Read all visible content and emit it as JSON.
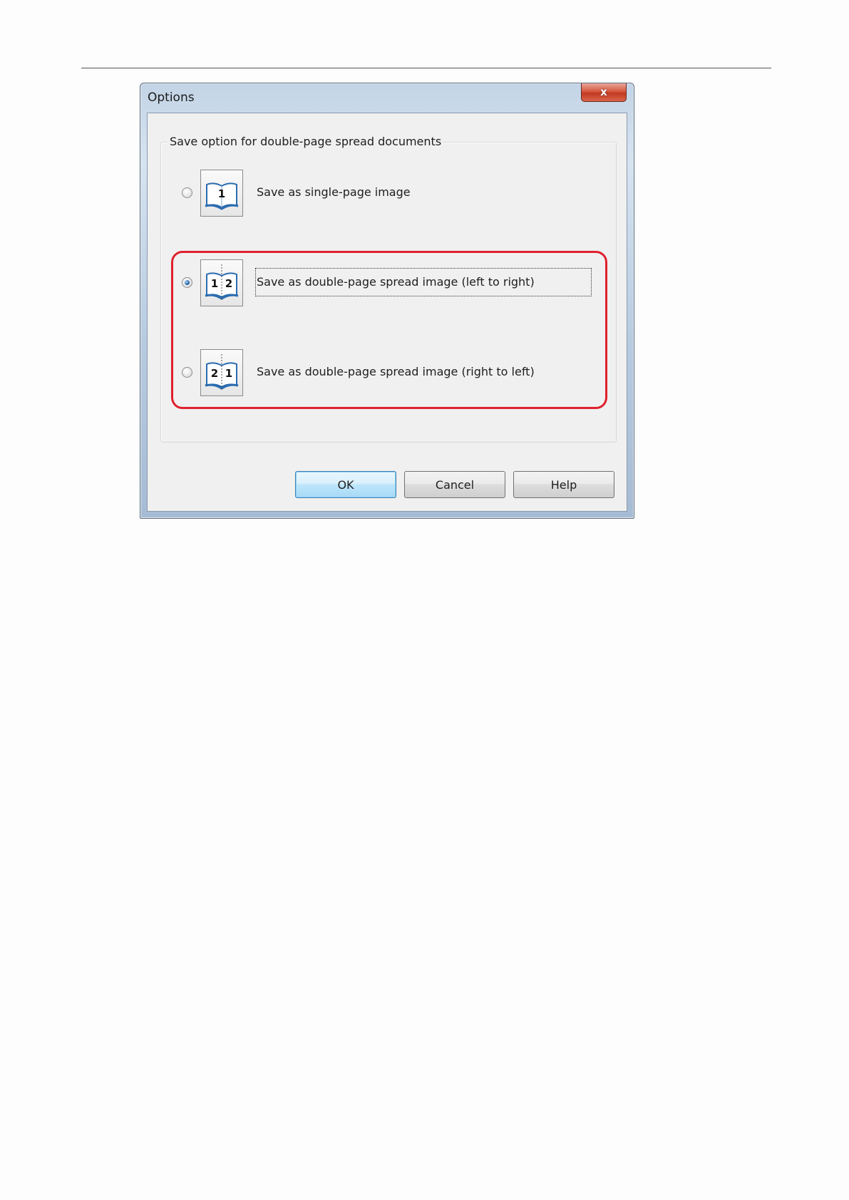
{
  "dialog": {
    "title": "Options",
    "close_glyph": "x"
  },
  "group": {
    "legend": "Save option for double-page spread documents"
  },
  "options": [
    {
      "label": "Save as single-page image",
      "icon": "single-page-book-icon",
      "icon_numbers": [
        "1"
      ],
      "checked": false
    },
    {
      "label": "Save as double-page spread image (left to right)",
      "icon": "left-to-right-book-icon",
      "icon_numbers": [
        "1",
        "2"
      ],
      "checked": true
    },
    {
      "label": "Save as double-page spread image (right to left)",
      "icon": "right-to-left-book-icon",
      "icon_numbers": [
        "2",
        "1"
      ],
      "checked": false
    }
  ],
  "buttons": {
    "ok": "OK",
    "cancel": "Cancel",
    "help": "Help"
  },
  "colors": {
    "highlight": "#e0202d",
    "close_button": "#c33a22",
    "default_button_border": "#3c7fb1"
  }
}
